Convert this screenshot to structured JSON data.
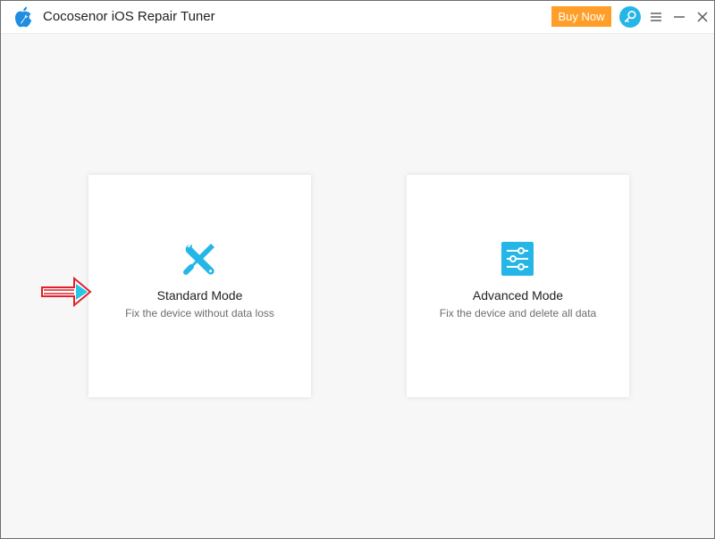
{
  "window": {
    "title": "Cocosenor iOS Repair Tuner"
  },
  "titlebar": {
    "logo_icon": "apple-wrench-logo-icon",
    "buy_label": "Buy Now",
    "key_icon": "key-icon",
    "menu_icon": "hamburger-menu-icon",
    "minimize_icon": "minimize-icon",
    "close_icon": "close-icon"
  },
  "modes": [
    {
      "title": "Standard Mode",
      "description": "Fix the device without data loss",
      "icon": "wrench-screwdriver-icon"
    },
    {
      "title": "Advanced Mode",
      "description": "Fix the device and delete all data",
      "icon": "sliders-icon"
    }
  ],
  "annotation": {
    "icon": "red-arrow-pointer-icon"
  },
  "colors": {
    "accent_blue": "#25b6e8",
    "buy_orange": "#ff9f2a",
    "background": "#f7f7f7",
    "arrow_red": "#e0202a"
  }
}
